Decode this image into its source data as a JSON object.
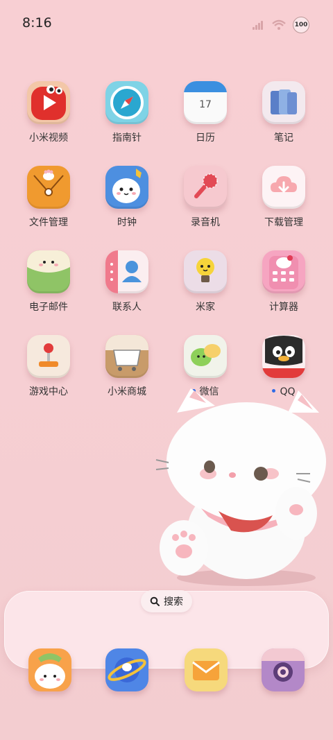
{
  "status_bar": {
    "time": "8:16",
    "battery_level": "100"
  },
  "apps": [
    {
      "label": "小米视频",
      "icon": "video-play-icon",
      "notify": false
    },
    {
      "label": "指南针",
      "icon": "compass-icon",
      "notify": false
    },
    {
      "label": "日历",
      "icon": "calendar-icon",
      "date": "17",
      "notify": false
    },
    {
      "label": "笔记",
      "icon": "notebook-icon",
      "notify": false
    },
    {
      "label": "文件管理",
      "icon": "file-folder-icon",
      "notify": false
    },
    {
      "label": "时钟",
      "icon": "clock-character-icon",
      "notify": false
    },
    {
      "label": "录音机",
      "icon": "microphone-icon",
      "notify": false
    },
    {
      "label": "下载管理",
      "icon": "cloud-download-icon",
      "notify": false
    },
    {
      "label": "电子邮件",
      "icon": "envelope-cat-icon",
      "notify": false
    },
    {
      "label": "联系人",
      "icon": "contacts-book-icon",
      "notify": false
    },
    {
      "label": "米家",
      "icon": "lightbulb-icon",
      "notify": false
    },
    {
      "label": "计算器",
      "icon": "calculator-icon",
      "notify": false
    },
    {
      "label": "游戏中心",
      "icon": "joystick-icon",
      "notify": false
    },
    {
      "label": "小米商城",
      "icon": "shopping-cart-icon",
      "notify": false
    },
    {
      "label": "微信",
      "icon": "chat-bubbles-icon",
      "notify": true
    },
    {
      "label": "QQ",
      "icon": "penguin-icon",
      "notify": true
    }
  ],
  "dock": {
    "search_label": "搜索",
    "apps": [
      {
        "icon": "phone-cat-icon"
      },
      {
        "icon": "browser-planet-icon"
      },
      {
        "icon": "mail-envelope-icon"
      },
      {
        "icon": "camera-icon"
      }
    ]
  },
  "colors": {
    "background": "#f8cfd3",
    "notify_dot": "#2f6be6"
  }
}
